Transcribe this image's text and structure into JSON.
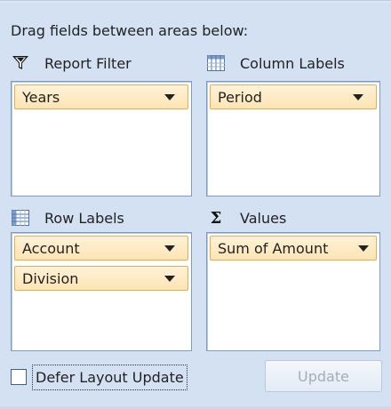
{
  "instructions": "Drag fields between areas below:",
  "areas": {
    "report_filter": {
      "label": "Report Filter",
      "icon": "filter-funnel-icon",
      "fields": [
        {
          "label": "Years"
        }
      ]
    },
    "column_labels": {
      "label": "Column Labels",
      "icon": "column-grid-icon",
      "fields": [
        {
          "label": "Period"
        }
      ]
    },
    "row_labels": {
      "label": "Row Labels",
      "icon": "row-grid-icon",
      "fields": [
        {
          "label": "Account"
        },
        {
          "label": "Division"
        }
      ]
    },
    "values": {
      "label": "Values",
      "icon": "sigma-icon",
      "symbol": "Σ",
      "fields": [
        {
          "label": "Sum of Amount"
        }
      ]
    }
  },
  "footer": {
    "defer_label": "Defer Layout Update",
    "defer_checked": false,
    "update_label": "Update",
    "update_enabled": false
  },
  "colors": {
    "panel_bg": "#d3e1f2",
    "zone_border": "#7a9cc6",
    "pill_border": "#e3ad52",
    "pill_fill": "#fde4b3"
  }
}
